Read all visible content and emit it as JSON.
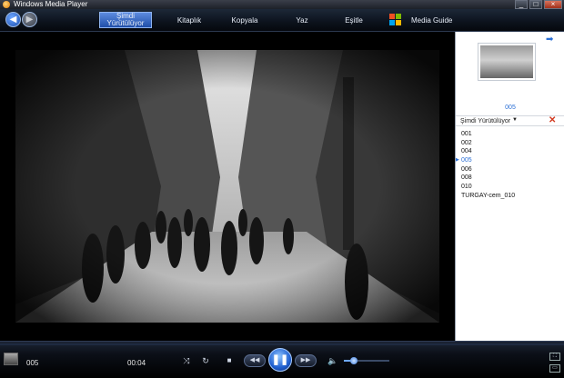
{
  "window": {
    "title": "Windows Media Player"
  },
  "nav": {
    "tabs": [
      {
        "label": "Şimdi Yürütülüyor",
        "active": true
      },
      {
        "label": "Kitaplık"
      },
      {
        "label": "Kopyala"
      },
      {
        "label": "Yaz"
      },
      {
        "label": "Eşitle"
      },
      {
        "label": "Media Guide"
      }
    ]
  },
  "pane": {
    "current_title": "005",
    "playlist_label": "Şimdi Yürütülüyor",
    "items": [
      "001",
      "002",
      "004",
      "005",
      "006",
      "008",
      "010",
      "TURGAY-cem_010"
    ],
    "active_item": "005"
  },
  "player": {
    "now_playing": "005",
    "elapsed": "00:04",
    "volume_fraction": 0.22
  },
  "colors": {
    "accent": "#2a6fd6",
    "clear_icon": "#d23a20"
  }
}
